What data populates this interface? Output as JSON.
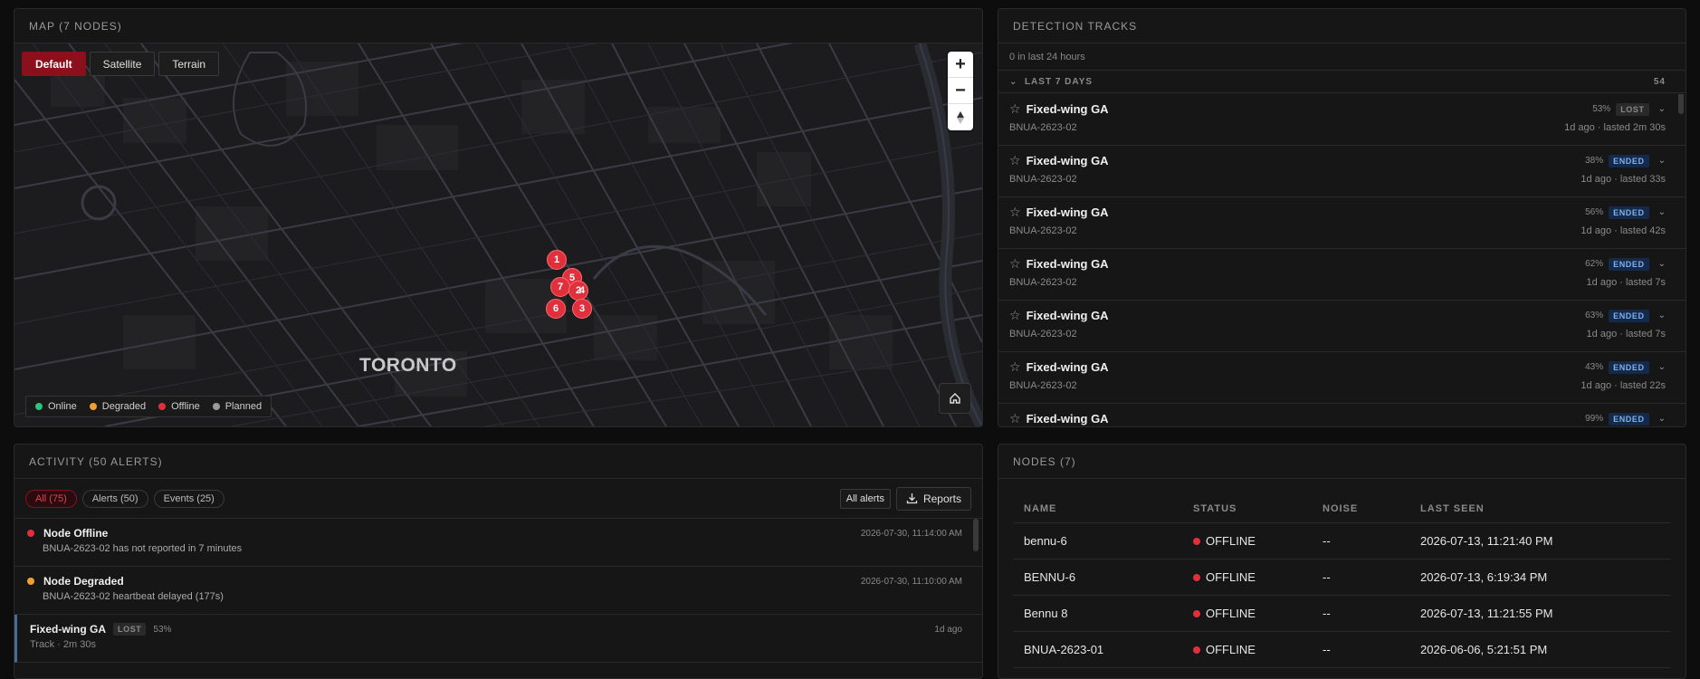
{
  "map": {
    "title": "MAP (7 NODES)",
    "tabs": [
      "Default",
      "Satellite",
      "Terrain"
    ],
    "city_label": "TORONTO",
    "markers": [
      "1",
      "5",
      "7",
      "2",
      "4",
      "6",
      "3"
    ],
    "legend": [
      {
        "label": "Online",
        "color": "#2ec27e"
      },
      {
        "label": "Degraded",
        "color": "#f0a030"
      },
      {
        "label": "Offline",
        "color": "#e0303c"
      },
      {
        "label": "Planned",
        "color": "#9a9a9a"
      }
    ]
  },
  "tracks": {
    "title": "DETECTION TRACKS",
    "summary": "0 in last 24 hours",
    "group_label": "LAST 7 DAYS",
    "group_count": "54",
    "items": [
      {
        "name": "Fixed-wing GA",
        "pct": "53%",
        "status": "LOST",
        "node": "BNUA-2623-02",
        "time": "1d ago · lasted 2m 30s"
      },
      {
        "name": "Fixed-wing GA",
        "pct": "38%",
        "status": "ENDED",
        "node": "BNUA-2623-02",
        "time": "1d ago · lasted 33s"
      },
      {
        "name": "Fixed-wing GA",
        "pct": "56%",
        "status": "ENDED",
        "node": "BNUA-2623-02",
        "time": "1d ago · lasted 42s"
      },
      {
        "name": "Fixed-wing GA",
        "pct": "62%",
        "status": "ENDED",
        "node": "BNUA-2623-02",
        "time": "1d ago · lasted 7s"
      },
      {
        "name": "Fixed-wing GA",
        "pct": "63%",
        "status": "ENDED",
        "node": "BNUA-2623-02",
        "time": "1d ago · lasted 7s"
      },
      {
        "name": "Fixed-wing GA",
        "pct": "43%",
        "status": "ENDED",
        "node": "BNUA-2623-02",
        "time": "1d ago · lasted 22s"
      },
      {
        "name": "Fixed-wing GA",
        "pct": "99%",
        "status": "ENDED",
        "node": "",
        "time": ""
      }
    ]
  },
  "activity": {
    "title": "ACTIVITY (50 ALERTS)",
    "chips": [
      "All (75)",
      "Alerts (50)",
      "Events (25)"
    ],
    "all_alerts_label": "All alerts",
    "reports_label": "Reports",
    "alerts": [
      {
        "title": "Node Offline",
        "sub": "BNUA-2623-02 has not reported in 7 minutes",
        "time": "2026-07-30, 11:14:00 AM",
        "color": "#e0303c"
      },
      {
        "title": "Node Degraded",
        "sub": "BNUA-2623-02 heartbeat delayed (177s)",
        "time": "2026-07-30, 11:10:00 AM",
        "color": "#f0a030"
      }
    ],
    "track_event": {
      "title": "Fixed-wing GA",
      "badge": "LOST",
      "pct": "53%",
      "sub": "Track · 2m 30s",
      "time": "1d ago"
    }
  },
  "nodes": {
    "title": "NODES (7)",
    "columns": [
      "NAME",
      "STATUS",
      "NOISE",
      "LAST SEEN"
    ],
    "rows": [
      {
        "name": "bennu-6",
        "status": "OFFLINE",
        "noise": "--",
        "last_seen": "2026-07-13, 11:21:40 PM"
      },
      {
        "name": "BENNU-6",
        "status": "OFFLINE",
        "noise": "--",
        "last_seen": "2026-07-13, 6:19:34 PM"
      },
      {
        "name": "Bennu 8",
        "status": "OFFLINE",
        "noise": "--",
        "last_seen": "2026-07-13, 11:21:55 PM"
      },
      {
        "name": "BNUA-2623-01",
        "status": "OFFLINE",
        "noise": "--",
        "last_seen": "2026-06-06, 5:21:51 PM"
      }
    ],
    "status_color": "#e0303c"
  }
}
